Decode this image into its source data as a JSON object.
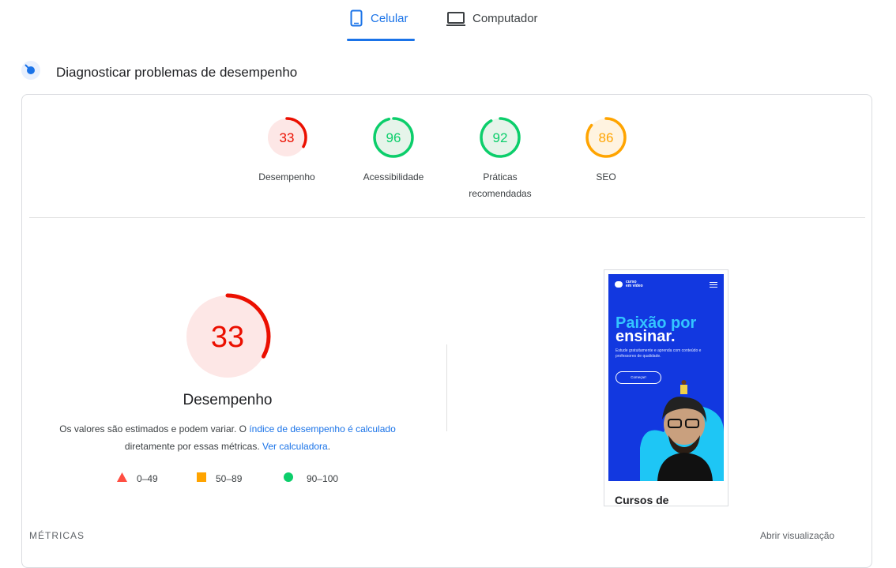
{
  "tabs": [
    {
      "label": "Celular",
      "icon": "smartphone-icon",
      "selected": true
    },
    {
      "label": "Computador",
      "icon": "laptop-icon",
      "selected": false
    }
  ],
  "diagnose": {
    "title": "Diagnosticar problemas de desempenho",
    "icon": "gauge-icon"
  },
  "scores": [
    {
      "value": 33,
      "label": "Desempenho",
      "color": "#eb0f00",
      "bg": "#fde7e6"
    },
    {
      "value": 96,
      "label": "Acessibilidade",
      "color": "#0cce6b",
      "bg": "#e6f4ea"
    },
    {
      "value": 92,
      "label": "Práticas recomendadas",
      "color": "#0cce6b",
      "bg": "#e6f4ea"
    },
    {
      "value": 86,
      "label": "SEO",
      "color": "#ffa400",
      "bg": "#fff3e0"
    }
  ],
  "main_score": {
    "value": 33,
    "title": "Desempenho",
    "desc_prefix": "Os valores são estimados e podem variar. O ",
    "desc_link1": "índice de desempenho é calculado",
    "desc_middle": " diretamente por essas métricas. ",
    "desc_link2": "Ver calculadora",
    "desc_end": "."
  },
  "legend": [
    {
      "range": "0–49",
      "shape": "triangle",
      "color": "#ff4e42"
    },
    {
      "range": "50–89",
      "shape": "square",
      "color": "#ffa400"
    },
    {
      "range": "90–100",
      "shape": "circle",
      "color": "#0cce6b"
    }
  ],
  "screenshot": {
    "logo_line1": "curso",
    "logo_line2": "em vídeo",
    "hero_line1": "Paixão por",
    "hero_line2": "ensinar.",
    "hero_sub": "Estude gratuitamente e aprenda com conteúdo e professores de qualidade.",
    "hero_button": "Começar!",
    "below_title": "Cursos de"
  },
  "metrics_label": "MÉTRICAS",
  "expand_label": "Abrir visualização"
}
